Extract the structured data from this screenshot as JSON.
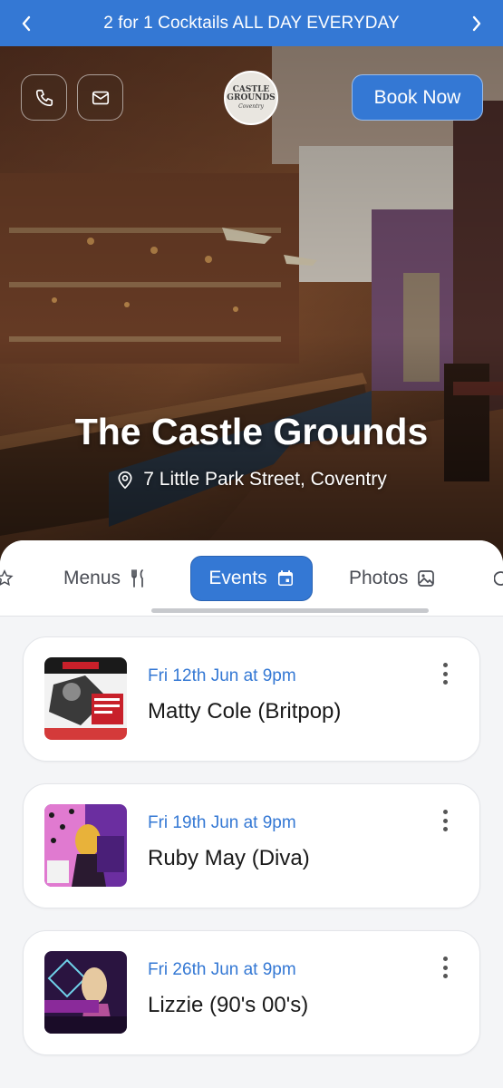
{
  "promo": {
    "text": "2 for 1 Cocktails ALL DAY EVERYDAY",
    "prev_icon": "chevron-left-icon",
    "next_icon": "chevron-right-icon"
  },
  "hero": {
    "logo": {
      "line1": "CASTLE",
      "line2": "GROUNDS",
      "line3": "Coventry"
    },
    "book_label": "Book Now",
    "title": "The Castle Grounds",
    "address": "7 Little Park Street, Coventry",
    "phone_icon": "phone-icon",
    "mail_icon": "mail-icon",
    "pin_icon": "map-pin-icon"
  },
  "tabs": [
    {
      "label": "Menus",
      "icon": "utensils-icon"
    },
    {
      "label": "Events",
      "icon": "calendar-icon",
      "active": true
    },
    {
      "label": "Photos",
      "icon": "image-icon"
    }
  ],
  "events": [
    {
      "date": "Fri 12th Jun at 9pm",
      "name": "Matty Cole (Britpop)"
    },
    {
      "date": "Fri 19th Jun at 9pm",
      "name": "Ruby May (Diva)"
    },
    {
      "date": "Fri 26th Jun at 9pm",
      "name": "Lizzie (90's 00's)"
    }
  ],
  "colors": {
    "accent": "#3478d4",
    "text": "#1a1a1a",
    "muted": "#4a4d55"
  }
}
